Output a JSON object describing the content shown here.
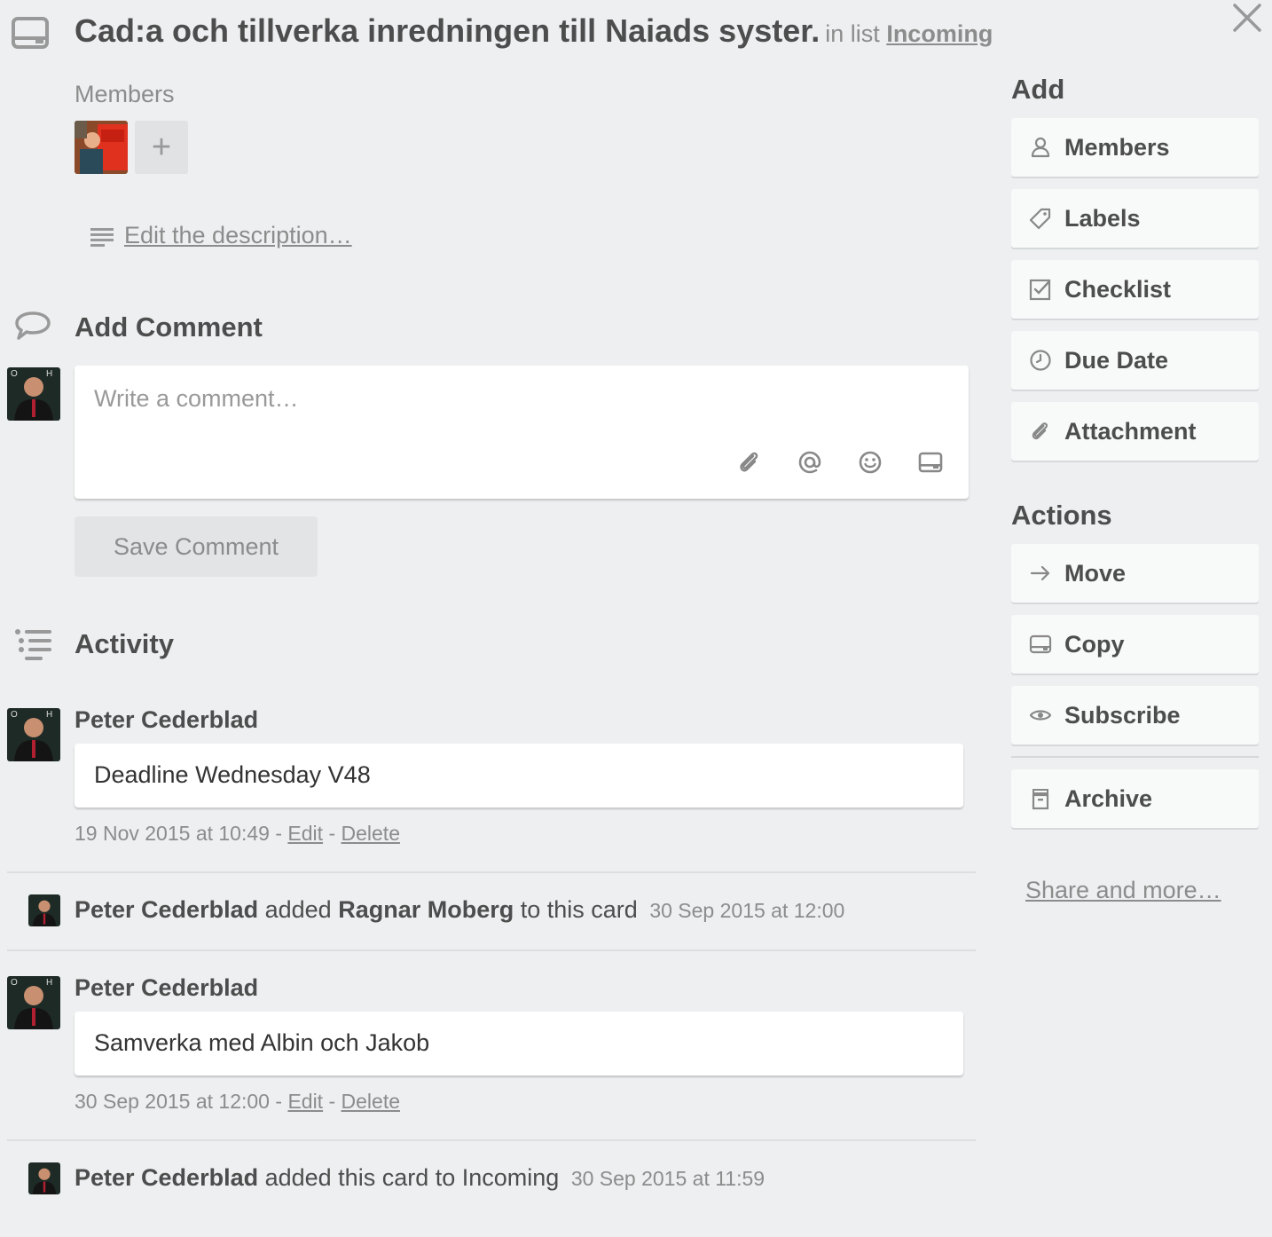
{
  "card": {
    "title": "Cad:a och tillverka inredningen till Naiads syster.",
    "in_list_prefix": "in list",
    "list_name": "Incoming"
  },
  "members": {
    "label": "Members",
    "add_symbol": "+"
  },
  "description": {
    "edit_link": "Edit the description…"
  },
  "add_comment": {
    "title": "Add Comment",
    "placeholder": "Write a comment…",
    "save_label": "Save Comment",
    "tools": [
      "paperclip-icon",
      "at-sign-icon",
      "smiley-icon",
      "card-icon"
    ]
  },
  "activity": {
    "title": "Activity",
    "items": [
      {
        "type": "comment",
        "author": "Peter Cederblad",
        "text": "Deadline Wednesday V48",
        "timestamp": "19 Nov 2015 at 10:49",
        "separator": "-",
        "edit": "Edit",
        "delete": "Delete"
      },
      {
        "type": "action",
        "author": "Peter Cederblad",
        "verb": "added",
        "target": "Ragnar Moberg",
        "rest": "to this card",
        "timestamp": "30 Sep 2015 at 12:00"
      },
      {
        "type": "comment",
        "author": "Peter Cederblad",
        "text": "Samverka med Albin och Jakob",
        "timestamp": "30 Sep 2015 at 12:00",
        "separator": "-",
        "edit": "Edit",
        "delete": "Delete"
      },
      {
        "type": "action",
        "author": "Peter Cederblad",
        "rest": "added this card to Incoming",
        "timestamp": "30 Sep 2015 at 11:59"
      }
    ]
  },
  "sidebar": {
    "add_heading": "Add",
    "add_buttons": [
      {
        "label": "Members",
        "icon": "person-icon"
      },
      {
        "label": "Labels",
        "icon": "tag-icon"
      },
      {
        "label": "Checklist",
        "icon": "checkbox-icon"
      },
      {
        "label": "Due Date",
        "icon": "clock-icon"
      },
      {
        "label": "Attachment",
        "icon": "paperclip-icon"
      }
    ],
    "actions_heading": "Actions",
    "action_buttons": [
      {
        "label": "Move",
        "icon": "arrow-right-icon"
      },
      {
        "label": "Copy",
        "icon": "card-icon"
      },
      {
        "label": "Subscribe",
        "icon": "eye-icon"
      },
      {
        "label": "Archive",
        "icon": "archive-box-icon"
      }
    ],
    "share_link": "Share and more…"
  },
  "colors": {
    "background": "#edeff0",
    "text": "#4d4d4d",
    "muted": "#8c8c8c",
    "button_bg": "#f8f9f9"
  }
}
